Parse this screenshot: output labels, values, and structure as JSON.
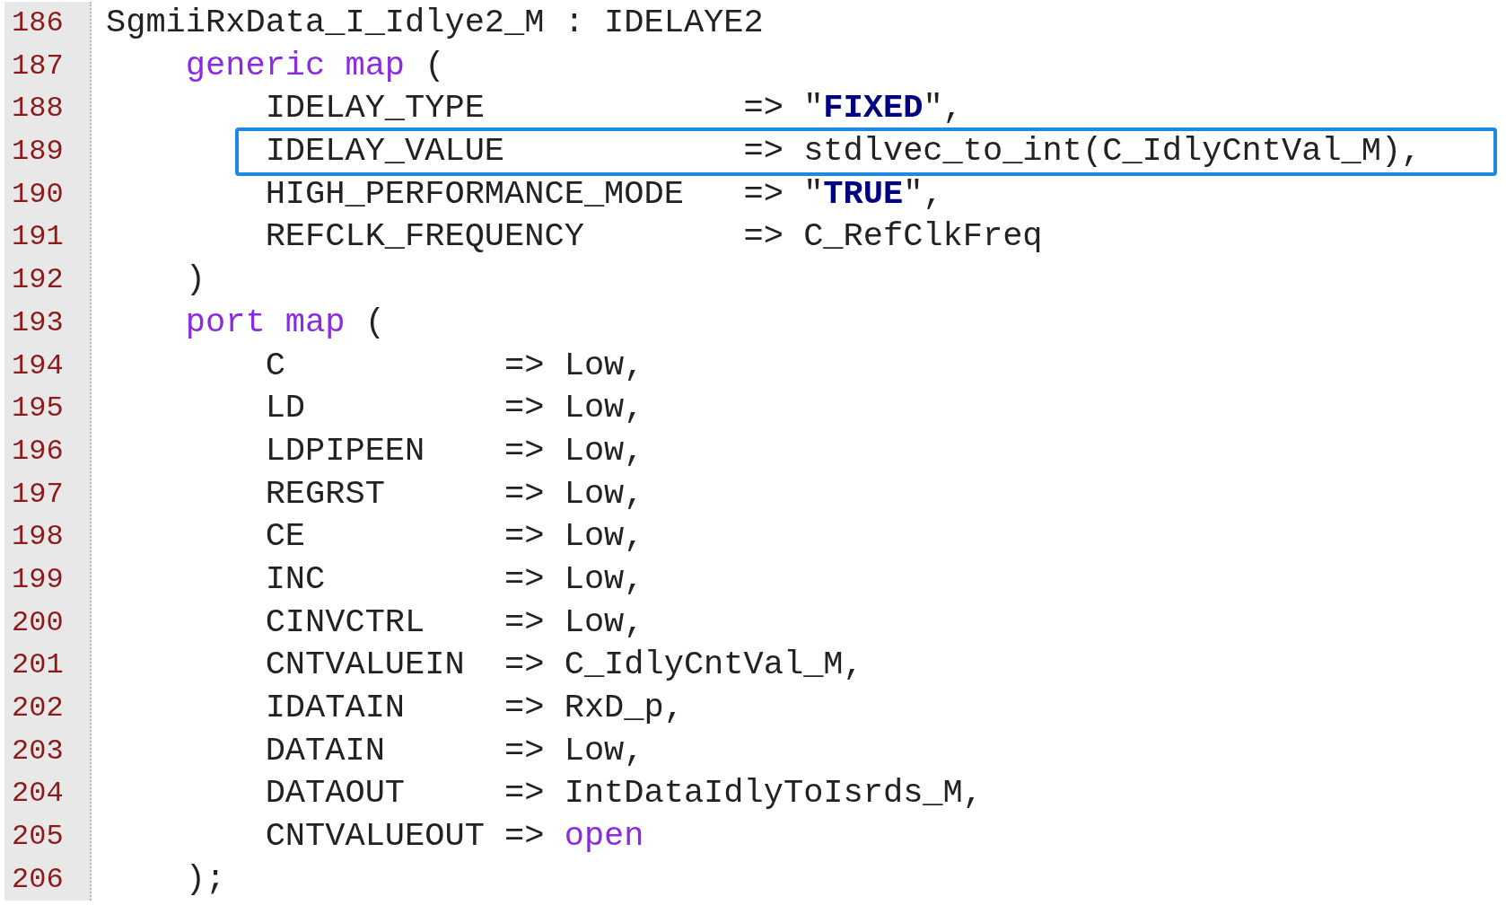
{
  "lines": [
    {
      "number": "186",
      "highlighted": false,
      "tokens": [
        {
          "kind": "plain",
          "text": "SgmiiRxData_I_Idlye2_M : IDELAYE2"
        }
      ]
    },
    {
      "number": "187",
      "highlighted": false,
      "tokens": [
        {
          "kind": "keyword",
          "text": "    generic map"
        },
        {
          "kind": "plain",
          "text": " ("
        }
      ]
    },
    {
      "number": "188",
      "highlighted": false,
      "tokens": [
        {
          "kind": "plain",
          "text": "        IDELAY_TYPE             => \""
        },
        {
          "kind": "constant",
          "text": "FIXED"
        },
        {
          "kind": "plain",
          "text": "\","
        }
      ]
    },
    {
      "number": "189",
      "highlighted": true,
      "tokens": [
        {
          "kind": "plain",
          "text": "        IDELAY_VALUE            => stdlvec_to_int(C_IdlyCntVal_M),"
        }
      ]
    },
    {
      "number": "190",
      "highlighted": false,
      "tokens": [
        {
          "kind": "plain",
          "text": "        HIGH_PERFORMANCE_MODE   => \""
        },
        {
          "kind": "constant",
          "text": "TRUE"
        },
        {
          "kind": "plain",
          "text": "\","
        }
      ]
    },
    {
      "number": "191",
      "highlighted": false,
      "tokens": [
        {
          "kind": "plain",
          "text": "        REFCLK_FREQUENCY        => C_RefClkFreq"
        }
      ]
    },
    {
      "number": "192",
      "highlighted": false,
      "tokens": [
        {
          "kind": "plain",
          "text": "    )"
        }
      ]
    },
    {
      "number": "193",
      "highlighted": false,
      "tokens": [
        {
          "kind": "keyword",
          "text": "    port map"
        },
        {
          "kind": "plain",
          "text": " ("
        }
      ]
    },
    {
      "number": "194",
      "highlighted": false,
      "tokens": [
        {
          "kind": "plain",
          "text": "        C           => Low,"
        }
      ]
    },
    {
      "number": "195",
      "highlighted": false,
      "tokens": [
        {
          "kind": "plain",
          "text": "        LD          => Low,"
        }
      ]
    },
    {
      "number": "196",
      "highlighted": false,
      "tokens": [
        {
          "kind": "plain",
          "text": "        LDPIPEEN    => Low,"
        }
      ]
    },
    {
      "number": "197",
      "highlighted": false,
      "tokens": [
        {
          "kind": "plain",
          "text": "        REGRST      => Low,"
        }
      ]
    },
    {
      "number": "198",
      "highlighted": false,
      "tokens": [
        {
          "kind": "plain",
          "text": "        CE          => Low,"
        }
      ]
    },
    {
      "number": "199",
      "highlighted": false,
      "tokens": [
        {
          "kind": "plain",
          "text": "        INC         => Low,"
        }
      ]
    },
    {
      "number": "200",
      "highlighted": false,
      "tokens": [
        {
          "kind": "plain",
          "text": "        CINVCTRL    => Low,"
        }
      ]
    },
    {
      "number": "201",
      "highlighted": false,
      "tokens": [
        {
          "kind": "plain",
          "text": "        CNTVALUEIN  => C_IdlyCntVal_M,"
        }
      ]
    },
    {
      "number": "202",
      "highlighted": false,
      "tokens": [
        {
          "kind": "plain",
          "text": "        IDATAIN     => RxD_p,"
        }
      ]
    },
    {
      "number": "203",
      "highlighted": false,
      "tokens": [
        {
          "kind": "plain",
          "text": "        DATAIN      => Low,"
        }
      ]
    },
    {
      "number": "204",
      "highlighted": false,
      "tokens": [
        {
          "kind": "plain",
          "text": "        DATAOUT     => IntDataIdlyToIsrds_M,"
        }
      ]
    },
    {
      "number": "205",
      "highlighted": false,
      "tokens": [
        {
          "kind": "plain",
          "text": "        CNTVALUEOUT => "
        },
        {
          "kind": "keyword",
          "text": "open"
        }
      ]
    },
    {
      "number": "206",
      "highlighted": false,
      "tokens": [
        {
          "kind": "plain",
          "text": "    );"
        }
      ]
    }
  ]
}
